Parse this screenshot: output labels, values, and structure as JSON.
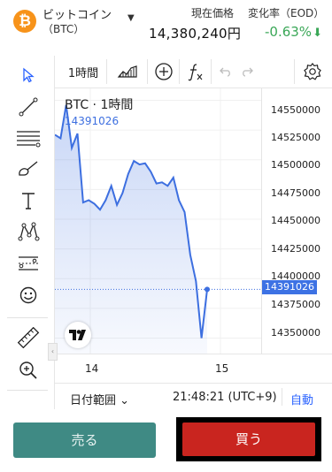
{
  "header": {
    "coin_symbol": "₿",
    "coin_name": "ビットコイン",
    "coin_code": "（BTC）",
    "price_label": "現在価格",
    "change_label": "変化率（EOD）",
    "price_value": "14,380,240円",
    "change_value": "-0.63%",
    "change_arrow": "⬇"
  },
  "toolbar": {
    "interval": "1時間"
  },
  "chart": {
    "title": "BTC · 1時間",
    "last_label": "14391026",
    "price_tag": "14391026",
    "y_ticks": [
      "14550000",
      "14525000",
      "14500000",
      "14475000",
      "14450000",
      "14425000",
      "14400000",
      "14375000",
      "14350000"
    ],
    "x_ticks": [
      "14",
      "15"
    ],
    "line_color": "#3d6fe0"
  },
  "chart_data": {
    "type": "area",
    "title": "BTC · 1時間",
    "x": [
      0,
      1,
      2,
      3,
      4,
      5,
      6,
      7,
      8,
      9,
      10,
      11,
      12,
      13,
      14,
      15,
      16,
      17,
      18,
      19,
      20,
      21,
      22,
      23,
      24,
      25,
      26,
      27
    ],
    "values": [
      14521000,
      14518000,
      14546000,
      14510000,
      14522000,
      14464000,
      14466000,
      14463000,
      14458000,
      14466000,
      14478000,
      14462000,
      14472000,
      14488000,
      14499000,
      14496000,
      14497000,
      14490000,
      14480000,
      14481000,
      14478000,
      14485000,
      14466000,
      14456000,
      14420000,
      14398000,
      14350000,
      14391026
    ],
    "ylim": [
      14337000,
      14560000
    ],
    "x_tick_labels": [
      "14",
      "15"
    ],
    "current": 14391026,
    "grid": true
  },
  "bottom": {
    "date_range": "日付範囲 ⌄",
    "time": "21:48:21 (UTC+9)",
    "auto": "自動"
  },
  "actions": {
    "sell": "売る",
    "buy": "買う"
  }
}
